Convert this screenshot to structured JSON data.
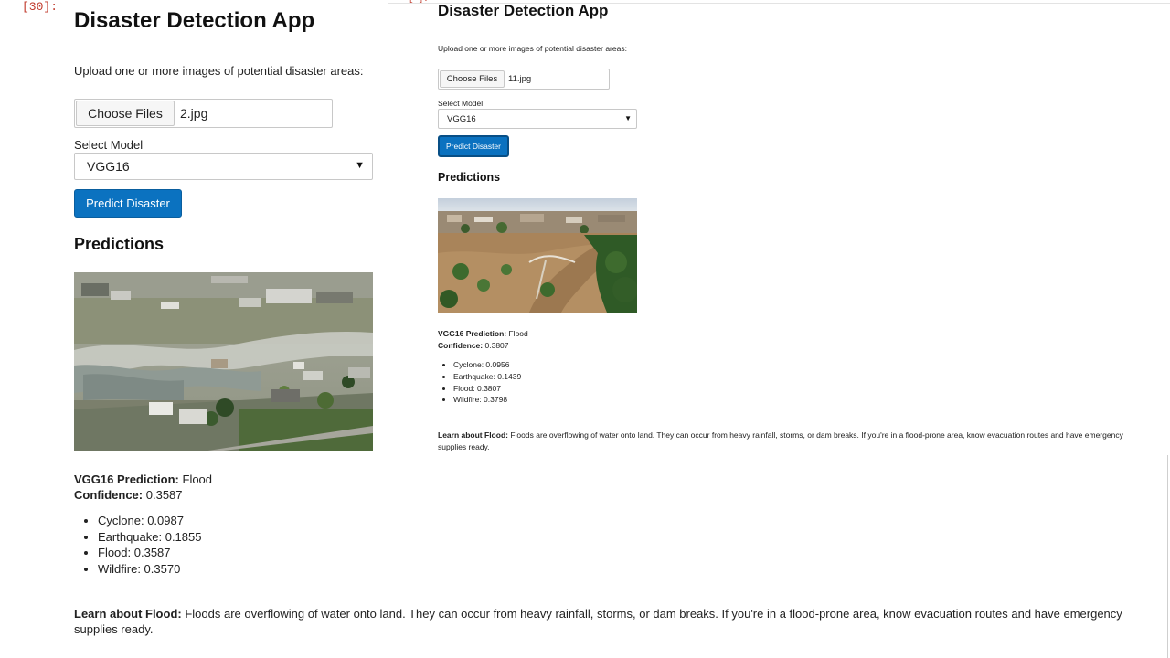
{
  "notebook": {
    "cell_prompt": "[30]:",
    "frame_prompt": "[ ]:"
  },
  "left_app": {
    "title": "Disaster Detection App",
    "upload_prompt": "Upload one or more images of potential disaster areas:",
    "choose_files_label": "Choose Files",
    "file_name": "2.jpg",
    "select_label": "Select Model",
    "selected_model": "VGG16",
    "predict_button": "Predict Disaster",
    "predictions_heading": "Predictions",
    "prediction_label": "VGG16 Prediction:",
    "prediction_value": "Flood",
    "confidence_label": "Confidence:",
    "confidence_value": "0.3587",
    "scores": [
      "Cyclone: 0.0987",
      "Earthquake: 0.1855",
      "Flood: 0.3587",
      "Wildfire: 0.3570"
    ],
    "learn_label": "Learn about Flood:",
    "learn_text": "Floods are overflowing of water onto land. They can occur from heavy rainfall, storms, or dam breaks. If you're in a flood-prone area, know evacuation routes and have emergency supplies ready."
  },
  "right_app": {
    "title": "Disaster Detection App",
    "upload_prompt": "Upload one or more images of potential disaster areas:",
    "choose_files_label": "Choose Files",
    "file_name": "11.jpg",
    "select_label": "Select Model",
    "selected_model": "VGG16",
    "predict_button": "Predict Disaster",
    "predictions_heading": "Predictions",
    "prediction_label": "VGG16 Prediction:",
    "prediction_value": "Flood",
    "confidence_label": "Confidence:",
    "confidence_value": "0.3807",
    "scores": [
      "Cyclone: 0.0956",
      "Earthquake: 0.1439",
      "Flood: 0.3807",
      "Wildfire: 0.3798"
    ],
    "learn_label": "Learn about Flood:",
    "learn_text": "Floods are overflowing of water onto land. They can occur from heavy rainfall, storms, or dam breaks. If you're in a flood-prone area, know evacuation routes and have emergency supplies ready."
  },
  "icons": {
    "dropdown": "chevron-down-icon",
    "list_bullet": "bullet-icon"
  },
  "colors": {
    "accent_button": "#0b72c0",
    "prompt_red": "#c0392b"
  }
}
